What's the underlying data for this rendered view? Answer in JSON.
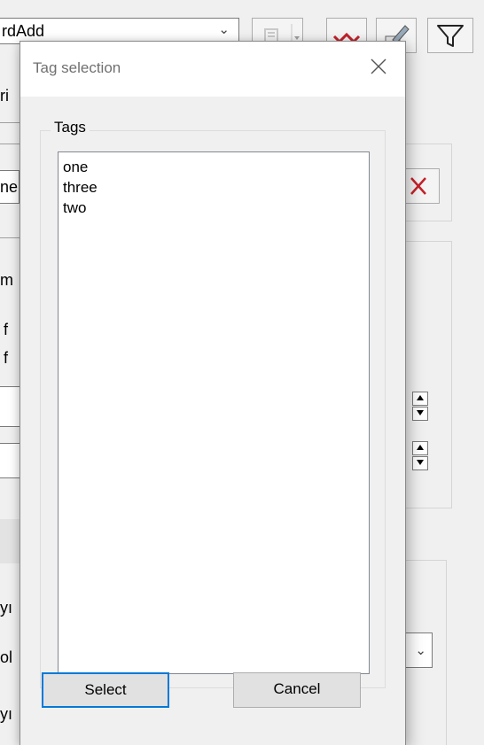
{
  "background_window": {
    "combo_text": "rdAdd",
    "left_fragments": [
      "ri",
      "ne",
      "m",
      "f",
      "f",
      "yı",
      "ol",
      "yı"
    ]
  },
  "dialog": {
    "title": "Tag selection",
    "group_label": "Tags",
    "tags": [
      "one",
      "three",
      "two"
    ],
    "select_button": "Select",
    "cancel_button": "Cancel"
  },
  "colors": {
    "accent": "#0078d7",
    "delete_red": "#c4212b"
  }
}
